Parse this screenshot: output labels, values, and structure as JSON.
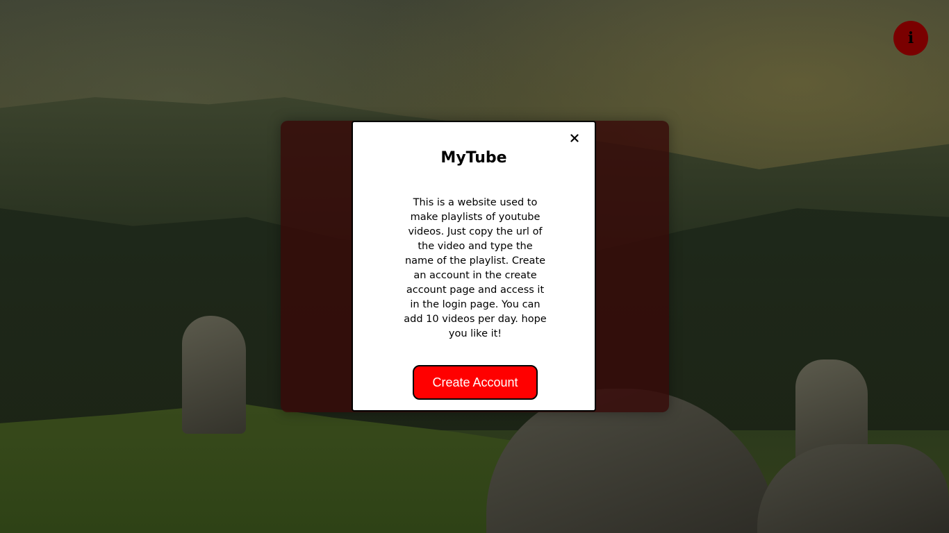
{
  "colors": {
    "accent": "#ff0000",
    "info_button": "#7a0000",
    "panel": "#370a08",
    "modal_bg": "#ffffff"
  },
  "info_button": {
    "icon": "info-icon",
    "glyph": "i"
  },
  "modal": {
    "title": "MyTube",
    "close_icon": "close-icon",
    "description": "This is a website used to make playlists of youtube videos. Just copy the url of the video and type the name of the playlist. Create an account in the create account page and access it in the login page. You can add 10 videos per day. hope you like it!",
    "cta_label": "Create Account"
  }
}
